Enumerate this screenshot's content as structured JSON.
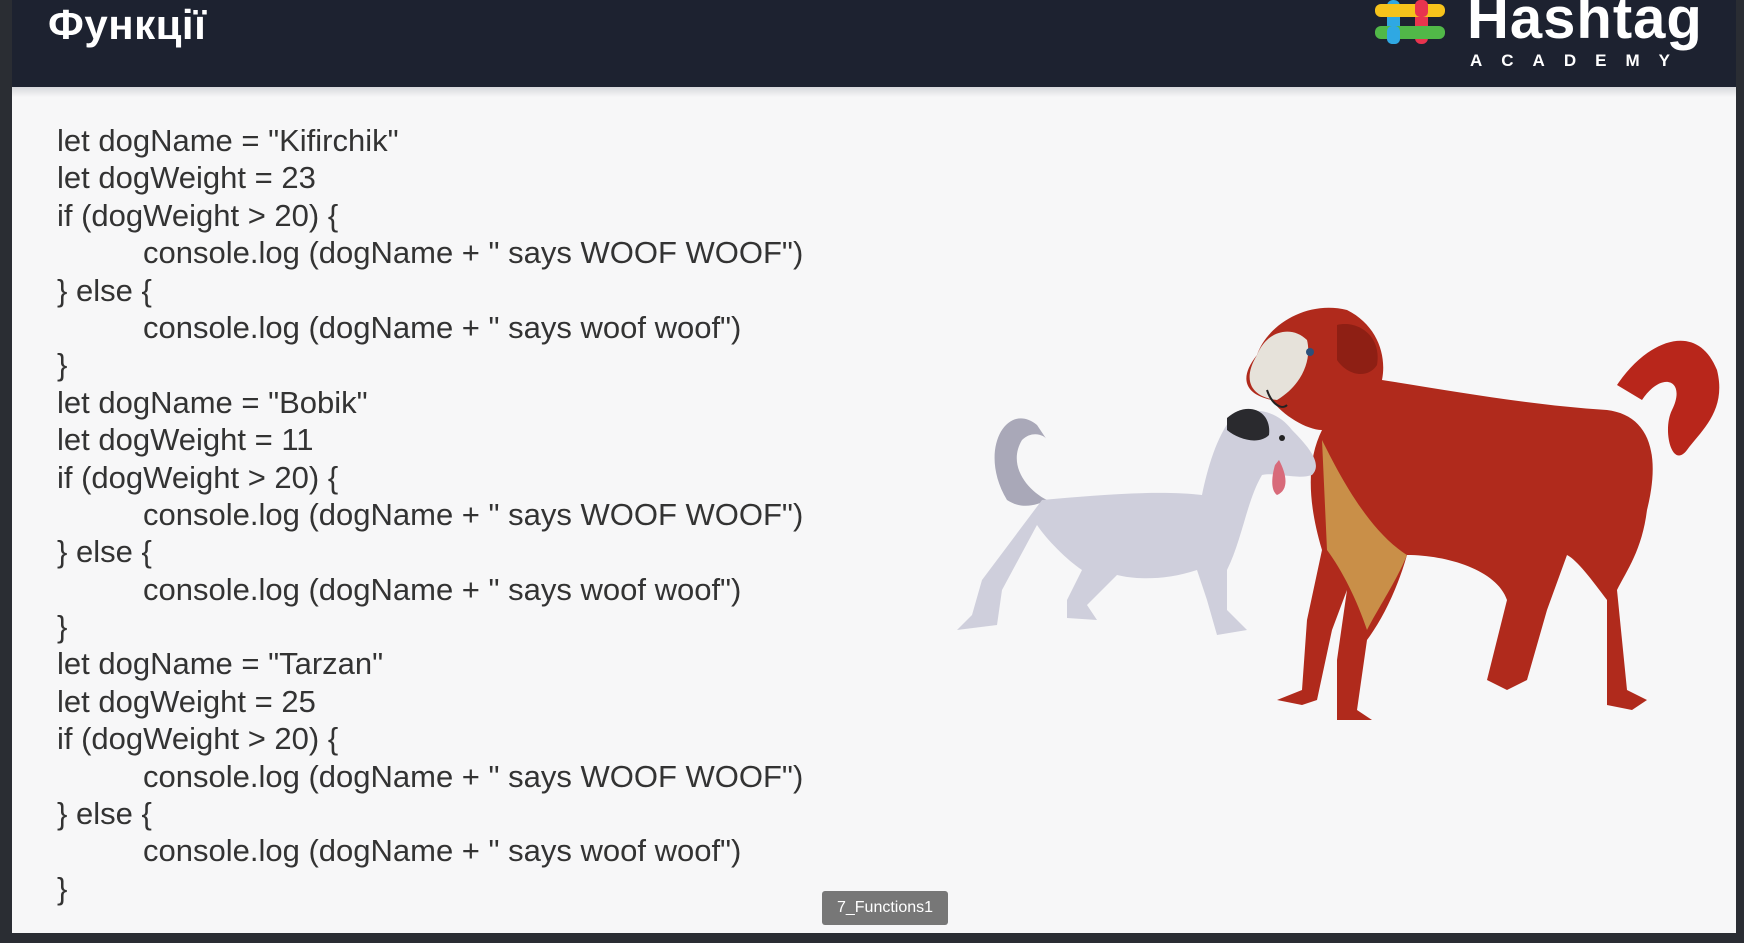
{
  "slide": {
    "title": "Функції",
    "logo": {
      "name": "Hashtag",
      "subtitle": "ACADEMY"
    },
    "code_lines": [
      {
        "text": "let dogName = \"Kifirchik\"",
        "indent": false
      },
      {
        "text": "let dogWeight = 23",
        "indent": false
      },
      {
        "text": "if (dogWeight > 20) {",
        "indent": false
      },
      {
        "text": "console.log (dogName + \" says WOOF WOOF\")",
        "indent": true
      },
      {
        "text": "} else {",
        "indent": false
      },
      {
        "text": "console.log (dogName + \" says woof woof\")",
        "indent": true
      },
      {
        "text": "}",
        "indent": false
      },
      {
        "text": "let dogName = \"Bobik\"",
        "indent": false
      },
      {
        "text": "let dogWeight = 11",
        "indent": false
      },
      {
        "text": "if (dogWeight > 20) {",
        "indent": false
      },
      {
        "text": "console.log (dogName + \" says WOOF WOOF\")",
        "indent": true
      },
      {
        "text": "} else {",
        "indent": false
      },
      {
        "text": "console.log (dogName + \" says woof woof\")",
        "indent": true
      },
      {
        "text": "}",
        "indent": false
      },
      {
        "text": "let dogName = \"Tarzan\"",
        "indent": false
      },
      {
        "text": "let dogWeight = 25",
        "indent": false
      },
      {
        "text": "if (dogWeight > 20) {",
        "indent": false
      },
      {
        "text": "console.log (dogName + \" says WOOF WOOF\")",
        "indent": true
      },
      {
        "text": "} else {",
        "indent": false
      },
      {
        "text": "console.log (dogName + \" says woof woof\")",
        "indent": true
      },
      {
        "text": "}",
        "indent": false
      }
    ],
    "illustration": "two-dogs-illustration",
    "tooltip": "7_Functions1"
  },
  "colors": {
    "header_bg": "#1d2230",
    "slide_bg": "#f7f7f8",
    "code_text": "#333333",
    "logo_red": "#e8344e",
    "logo_yellow": "#f6c31b",
    "logo_blue": "#2fa8e3",
    "logo_green": "#51b848"
  }
}
